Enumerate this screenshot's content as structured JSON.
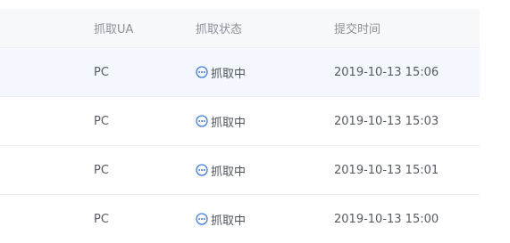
{
  "table": {
    "headers": {
      "ua": "抓取UA",
      "status": "抓取状态",
      "time": "提交时间"
    },
    "rows": [
      {
        "ua": "PC",
        "status": "抓取中",
        "status_icon": "ellipsis-circle-icon",
        "time": "2019-10-13 15:06"
      },
      {
        "ua": "PC",
        "status": "抓取中",
        "status_icon": "ellipsis-circle-icon",
        "time": "2019-10-13 15:03"
      },
      {
        "ua": "PC",
        "status": "抓取中",
        "status_icon": "ellipsis-circle-icon",
        "time": "2019-10-13 15:01"
      },
      {
        "ua": "PC",
        "status": "抓取中",
        "status_icon": "ellipsis-circle-icon",
        "time": "2019-10-13 15:00"
      }
    ]
  },
  "colors": {
    "header_bg": "#f7f8fa",
    "hover_row_bg": "#f4f7fd",
    "status_icon": "#3d7be0"
  }
}
